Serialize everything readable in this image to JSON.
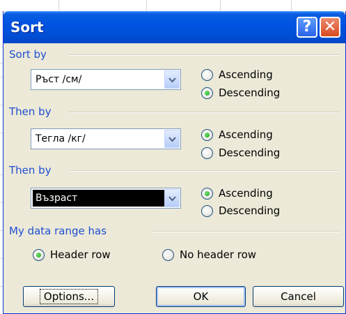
{
  "dialog": {
    "title": "Sort",
    "help_glyph": "?",
    "close_glyph": "✕"
  },
  "groups": [
    {
      "label": "Sort by",
      "field": "Ръст /см/",
      "ascending": "Ascending",
      "descending": "Descending",
      "selected": "descending"
    },
    {
      "label": "Then by",
      "field": "Тегла /кг/",
      "ascending": "Ascending",
      "descending": "Descending",
      "selected": "ascending"
    },
    {
      "label": "Then by",
      "field": "Възраст",
      "ascending": "Ascending",
      "descending": "Descending",
      "selected": "ascending"
    }
  ],
  "data_range": {
    "label": "My data range has",
    "header_row": "Header row",
    "no_header_row": "No header row",
    "selected": "header_row"
  },
  "buttons": {
    "options": "Options...",
    "ok": "OK",
    "cancel": "Cancel"
  },
  "colors": {
    "titlebar": "#0053e1",
    "dialog_bg": "#ece9d8",
    "group_label": "#1d4fd1",
    "close_button": "#d84b1f",
    "radio_dot": "#21a121"
  }
}
